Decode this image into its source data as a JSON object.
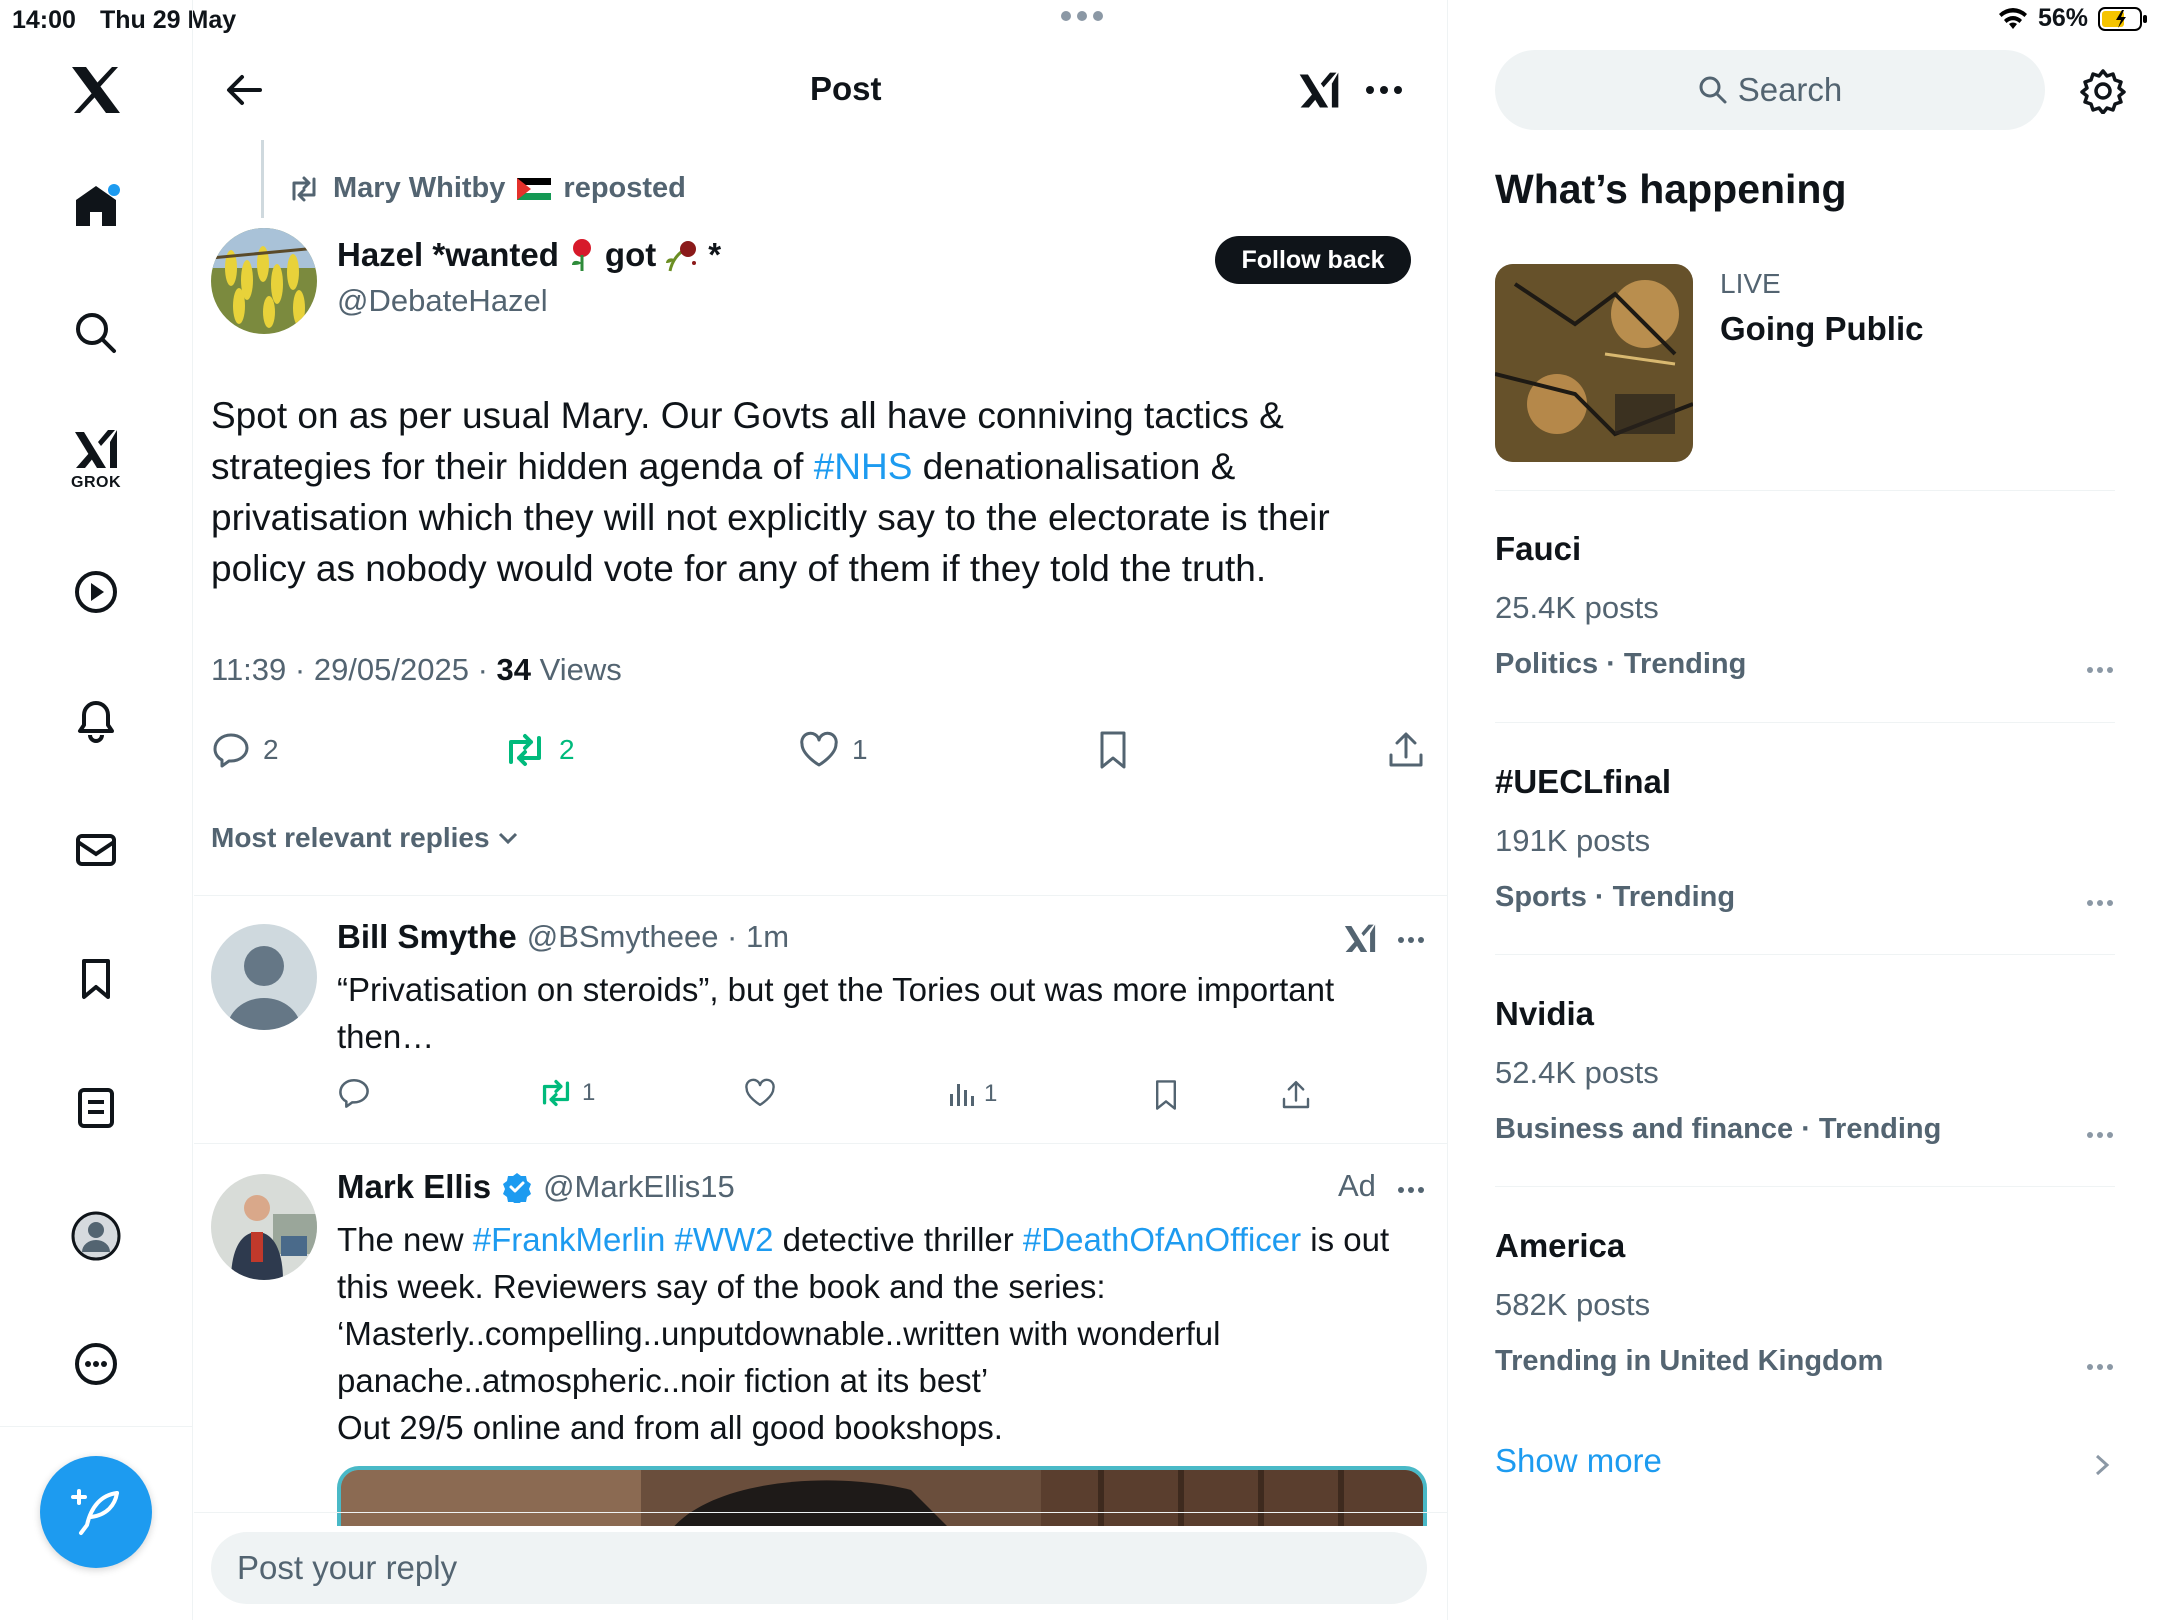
{
  "status_bar": {
    "time": "14:00",
    "date": "Thu 29 May",
    "battery": "56%"
  },
  "nav": {
    "items": [
      "home-icon",
      "search-icon",
      "grok-icon",
      "video-icon",
      "bell-icon",
      "mail-icon",
      "bookmark-icon",
      "lists-icon",
      "profile-icon",
      "more-icon"
    ],
    "grok_label": "GROK"
  },
  "header": {
    "title": "Post"
  },
  "post": {
    "repost_by": "Mary Whitby",
    "repost_suffix": "reposted",
    "author_name": "Hazel *wanted",
    "author_name_mid": "got",
    "author_name_end": "*",
    "author_handle": "@DebateHazel",
    "follow_label": "Follow back",
    "body_part1": "Spot on as per usual Mary.  Our Govts all have conniving tactics & strategies for their hidden agenda of ",
    "hashtag": "#NHS",
    "body_part2": " denationalisation & privatisation which they will not explicitly say to the electorate is their policy as nobody would vote for any of them if they told the truth.",
    "timestamp": "11:39 · 29/05/2025 · ",
    "views_count": "34",
    "views_label": " Views",
    "replies": "2",
    "reposts": "2",
    "likes": "1"
  },
  "replies_filter": {
    "label": "Most relevant replies"
  },
  "reply1": {
    "name": "Bill Smythe",
    "handle": "@BSmytheee · 1m",
    "text": "“Privatisation on steroids”, but get the Tories out was more important then…",
    "reposts": "1",
    "views": "1"
  },
  "reply2": {
    "name": "Mark Ellis",
    "handle": "@MarkEllis15",
    "ad_label": "Ad",
    "text_a": "The new ",
    "tag1": "#FrankMerlin",
    "tag2": "#WW2",
    "text_b": " detective  thriller ",
    "tag3": "#DeathOfAnOfficer",
    "text_c": " is out this week. Reviewers say of the book and the series: ‘Masterly..compelling..unputdownable..written with wonderful panache..atmospheric..noir fiction at its best’",
    "text_d": "Out 29/5 online and from all good bookshops."
  },
  "reply_box": {
    "placeholder": "Post your reply"
  },
  "sidebar": {
    "search_placeholder": "Search",
    "title": "What’s happening",
    "live_label": "LIVE",
    "live_title": "Going Public",
    "trends": [
      {
        "name": "Fauci",
        "count": "25.4K posts",
        "category": "Politics · Trending"
      },
      {
        "name": "#UECLfinal",
        "count": "191K posts",
        "category": "Sports · Trending"
      },
      {
        "name": "Nvidia",
        "count": "52.4K posts",
        "category": "Business and finance · Trending"
      },
      {
        "name": "America",
        "count": "582K posts",
        "category": "Trending in United Kingdom"
      }
    ],
    "show_more": "Show more"
  },
  "colors": {
    "accent": "#1d9bf0",
    "repost_green": "#00ba7c",
    "muted": "#536471"
  }
}
